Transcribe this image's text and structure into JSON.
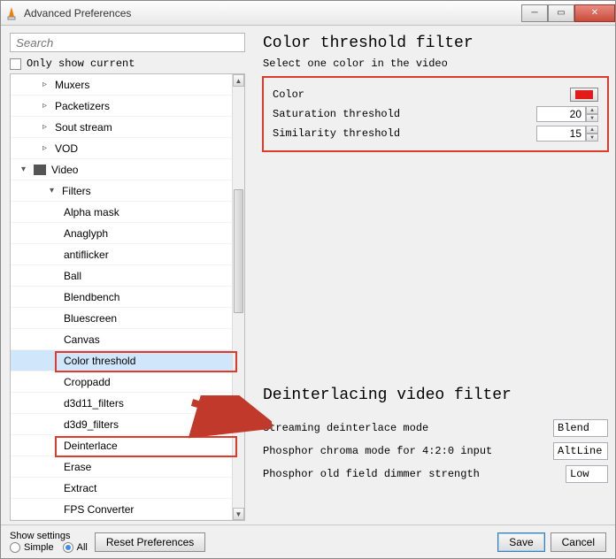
{
  "window": {
    "title": "Advanced Preferences"
  },
  "search": {
    "placeholder": "Search"
  },
  "only_current_label": "Only show current",
  "tree": {
    "items": [
      {
        "label": "Muxers",
        "level": 1,
        "arrow": "▹"
      },
      {
        "label": "Packetizers",
        "level": 1,
        "arrow": "▹"
      },
      {
        "label": "Sout stream",
        "level": 1,
        "arrow": "▹"
      },
      {
        "label": "VOD",
        "level": 1,
        "arrow": "▹"
      },
      {
        "label": "Video",
        "level": 0,
        "arrow": "▾",
        "icon": true
      },
      {
        "label": "Filters",
        "level": 2,
        "arrow": "▾"
      },
      {
        "label": "Alpha mask",
        "level": 3
      },
      {
        "label": "Anaglyph",
        "level": 3
      },
      {
        "label": "antiflicker",
        "level": 3
      },
      {
        "label": "Ball",
        "level": 3
      },
      {
        "label": "Blendbench",
        "level": 3
      },
      {
        "label": "Bluescreen",
        "level": 3
      },
      {
        "label": "Canvas",
        "level": 3
      },
      {
        "label": "Color threshold",
        "level": 3,
        "sel": true
      },
      {
        "label": "Croppadd",
        "level": 3
      },
      {
        "label": "d3d11_filters",
        "level": 3
      },
      {
        "label": "d3d9_filters",
        "level": 3
      },
      {
        "label": "Deinterlace",
        "level": 3
      },
      {
        "label": "Erase",
        "level": 3
      },
      {
        "label": "Extract",
        "level": 3
      },
      {
        "label": "FPS Converter",
        "level": 3
      }
    ]
  },
  "section1": {
    "title": "Color threshold filter",
    "subtitle": "Select one color in the video",
    "color_label": "Color",
    "sat_label": "Saturation threshold",
    "sat_value": "20",
    "sim_label": "Similarity threshold",
    "sim_value": "15"
  },
  "section2": {
    "title": "Deinterlacing video filter",
    "row1_label": "Streaming deinterlace mode",
    "row1_value": "Blend",
    "row2_label": "Phosphor chroma mode for 4:2:0 input",
    "row2_value": "AltLine",
    "row3_label": "Phosphor old field dimmer strength",
    "row3_value": "Low"
  },
  "footer": {
    "show_label": "Show settings",
    "simple": "Simple",
    "all": "All",
    "reset": "Reset Preferences",
    "save": "Save",
    "cancel": "Cancel"
  }
}
